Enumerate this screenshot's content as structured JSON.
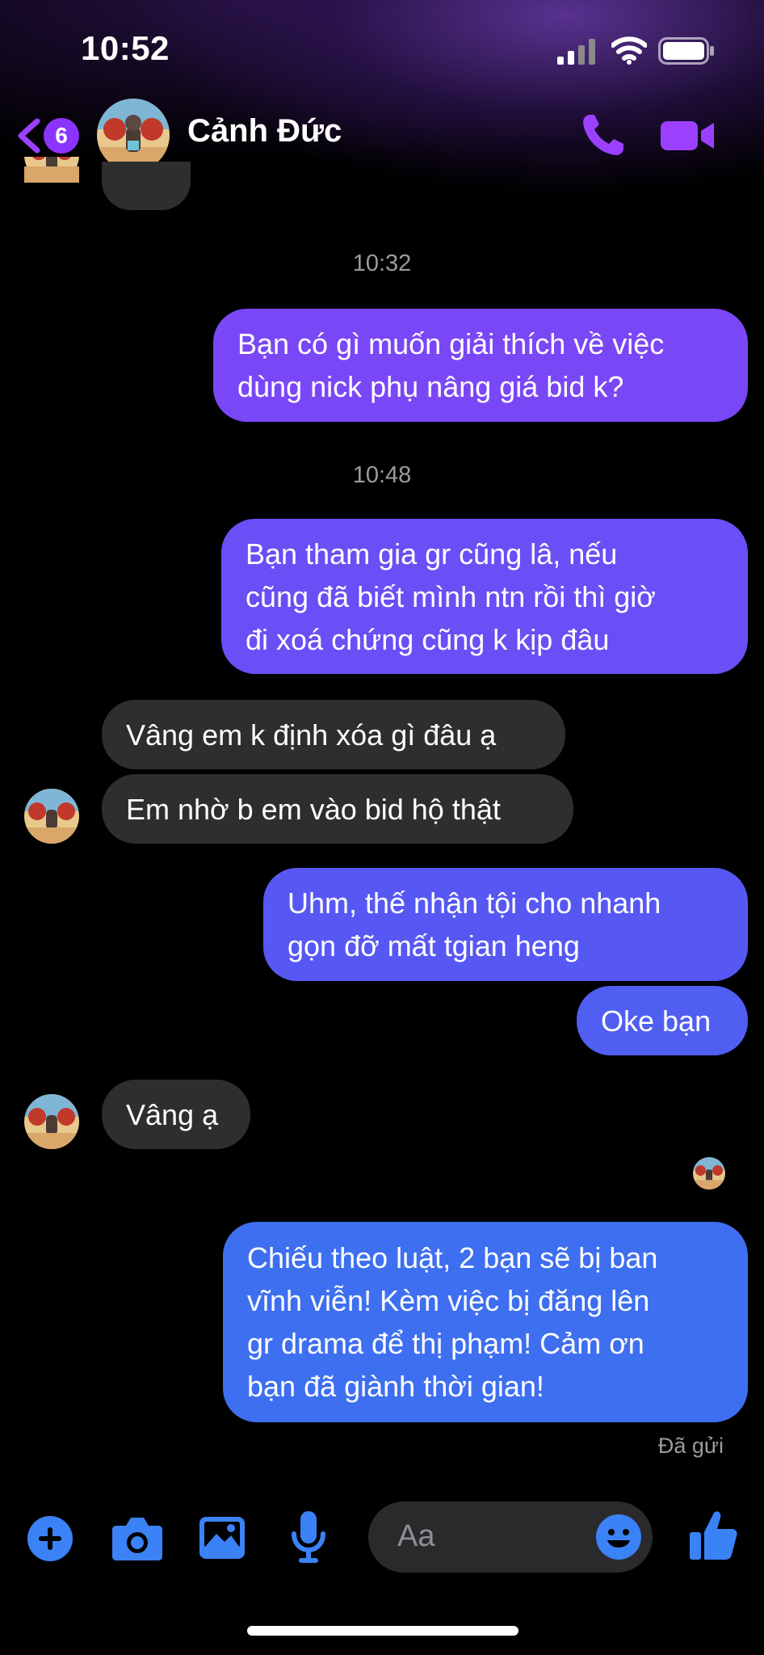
{
  "status_bar": {
    "time": "10:52"
  },
  "header": {
    "back_count": "6",
    "contact_name": "Cảnh Đức",
    "accent_color": "#9b40ff"
  },
  "messages": {
    "ts1": "10:32",
    "ts2": "10:48",
    "m1": "Bạn có gì muốn giải thích về việc\ndùng nick phụ nâng giá bid k?",
    "m2": "Bạn tham gia gr cũng lâ, nếu\ncũng đã biết mình ntn rồi thì giờ\nđi xoá chứng cũng k kịp đâu",
    "m3": "Vâng em k định xóa gì đâu ạ",
    "m4": "Em nhờ b em vào bid hộ thật",
    "m5": "Uhm, thế nhận tội cho nhanh\ngọn đỡ mất tgian heng",
    "m6": "Oke bạn",
    "m7": "Vâng ạ",
    "m8": "Chiếu theo luật, 2 bạn sẽ bị ban\nvĩnh viễn! Kèm việc bị đăng lên\ngr drama để thị phạm! Cảm ơn\nbạn đã giành thời gian!",
    "sent_status": "Đã gửi"
  },
  "composer": {
    "placeholder": "Aa",
    "icons": [
      "plus-icon",
      "camera-icon",
      "image-icon",
      "microphone-icon",
      "emoji-icon",
      "thumbs-up-icon"
    ],
    "icon_color": "#3b82f6"
  }
}
